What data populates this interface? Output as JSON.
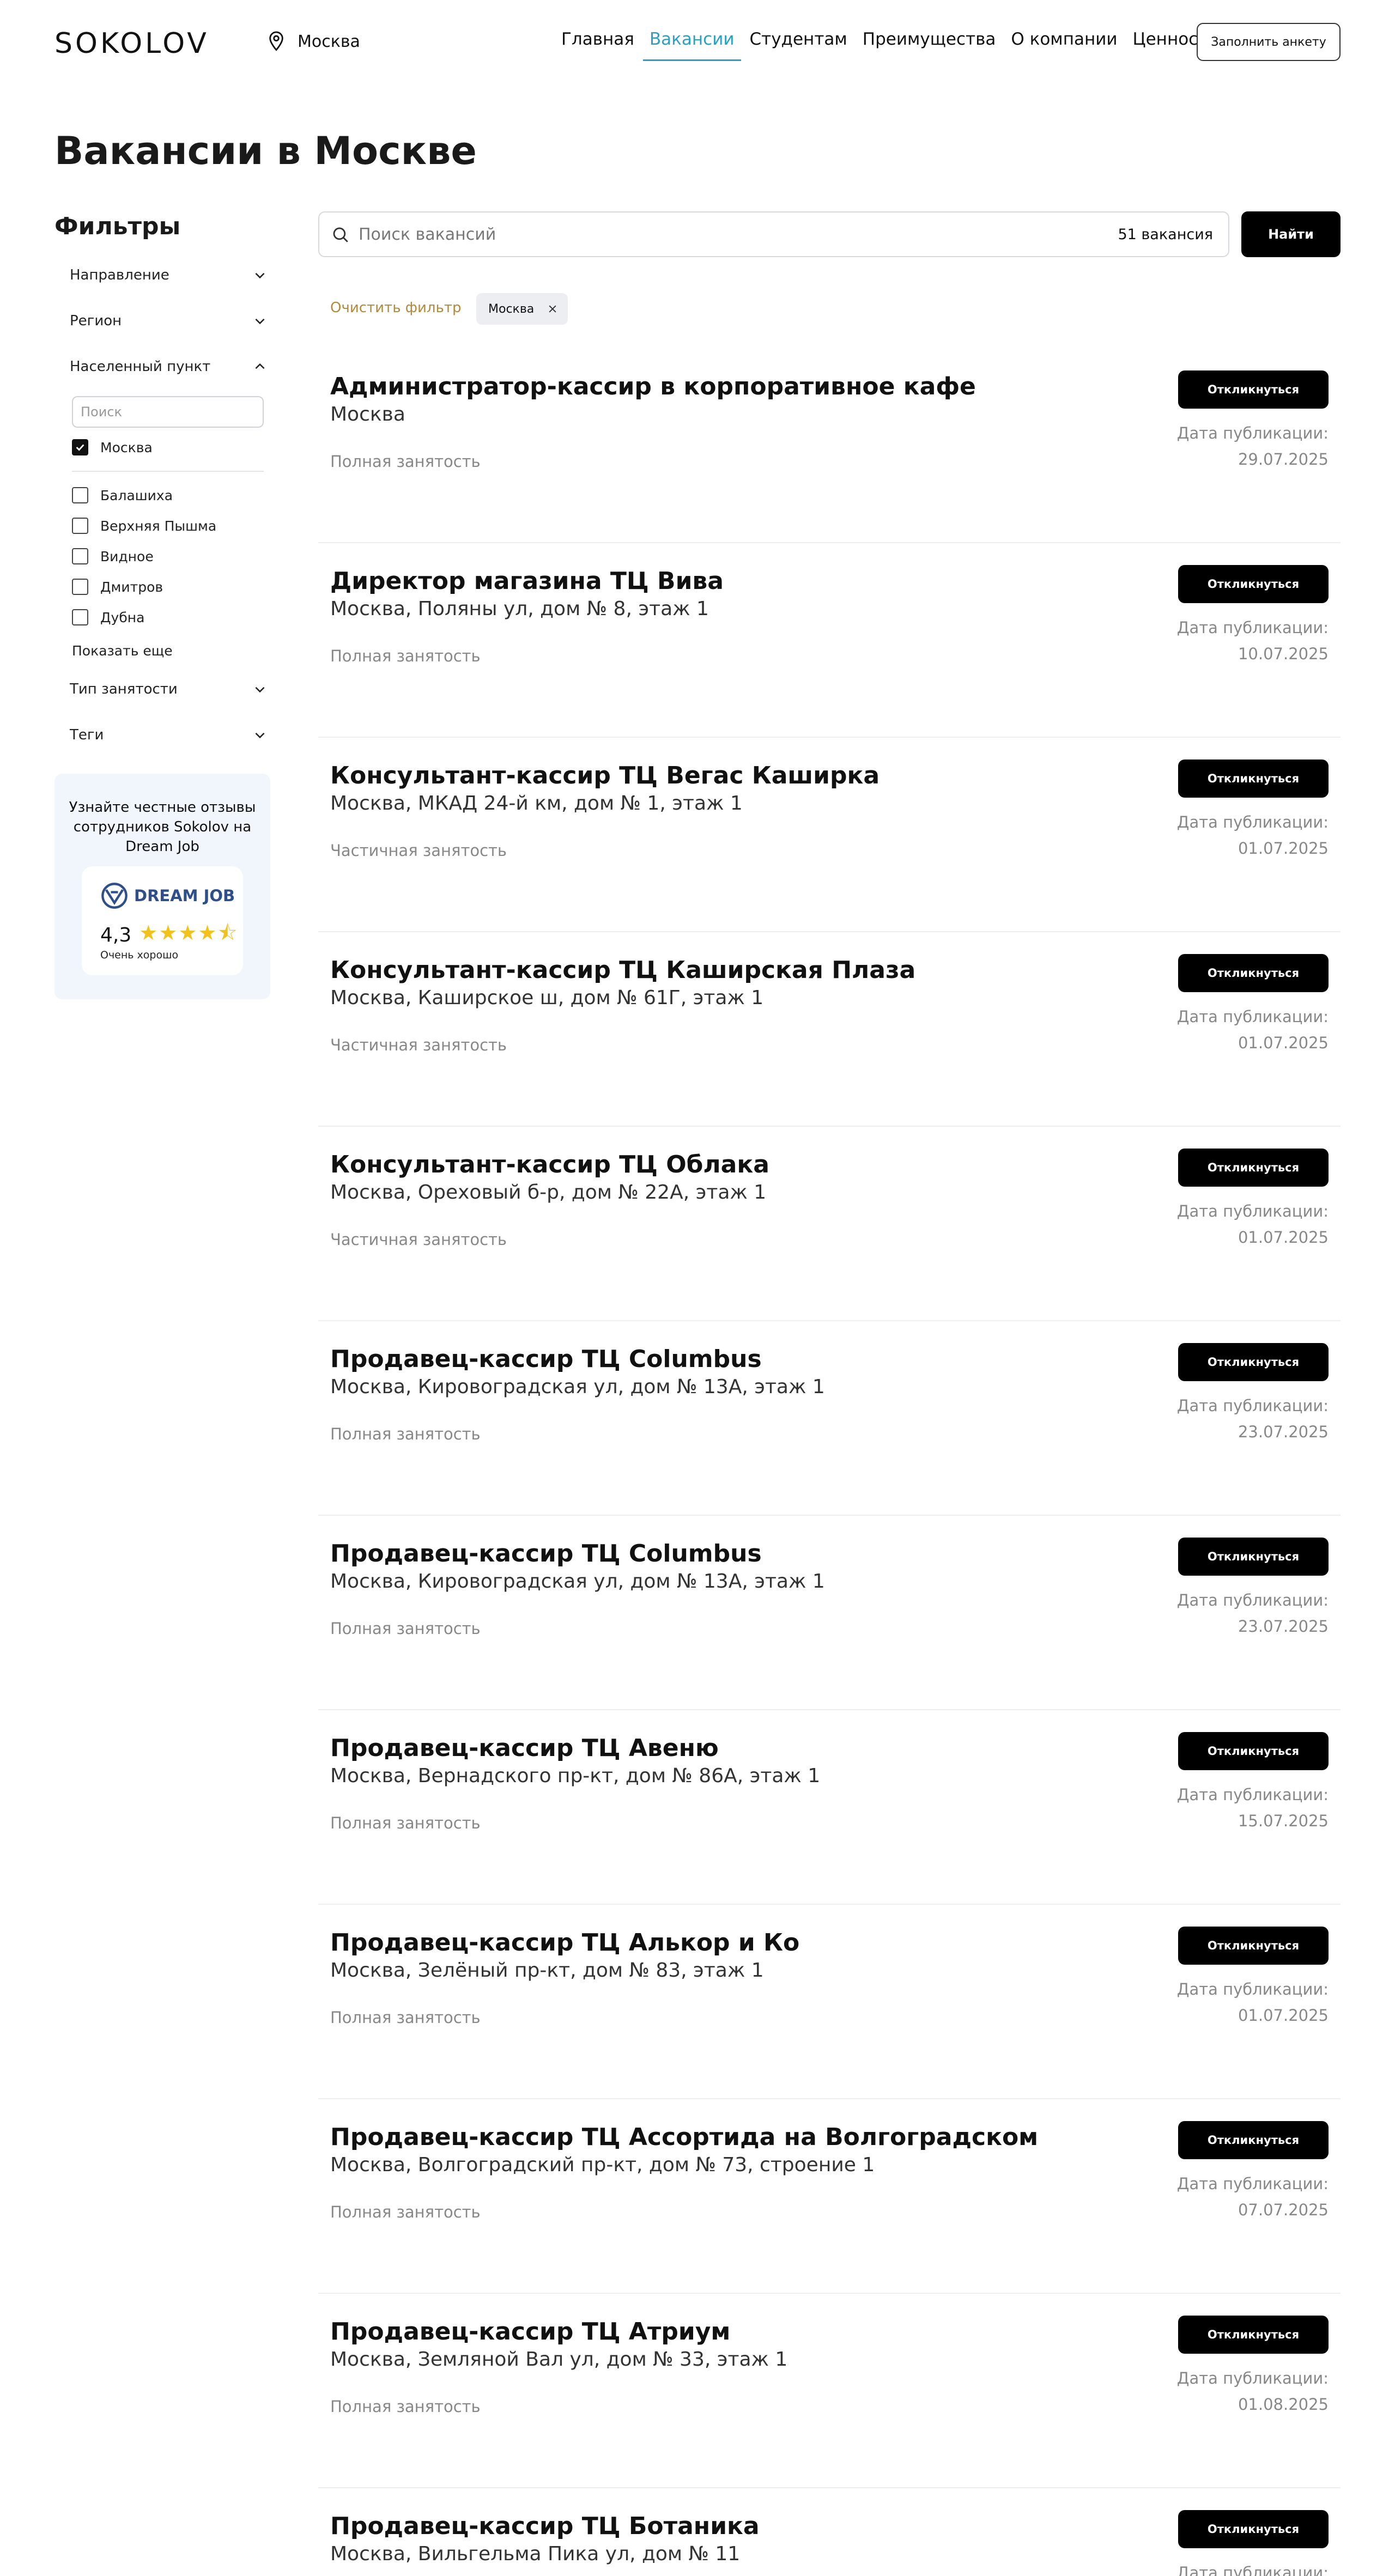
{
  "header": {
    "logo": "SOKOLOV",
    "city": "Москва",
    "nav": [
      "Главная",
      "Вакансии",
      "Студентам",
      "Преимущества",
      "О компании",
      "Ценности"
    ],
    "active_nav": "Вакансии",
    "fill_form_label": "Заполнить анкету"
  },
  "page_title": "Вакансии в Москве",
  "filters": {
    "title": "Фильтры",
    "direction": "Направление",
    "region": "Регион",
    "locality": "Населенный пункт",
    "locality_search_placeholder": "Поиск",
    "localities": [
      {
        "label": "Москва",
        "checked": true
      },
      {
        "label": "Балашиха",
        "checked": false
      },
      {
        "label": "Верхняя Пышма",
        "checked": false
      },
      {
        "label": "Видное",
        "checked": false
      },
      {
        "label": "Дмитров",
        "checked": false
      },
      {
        "label": "Дубна",
        "checked": false
      }
    ],
    "show_more": "Показать еще",
    "employment_type": "Тип занятости",
    "tags": "Теги"
  },
  "dream_job": {
    "text": "Узнайте честные отзывы сотрудников Sokolov на Dream Job",
    "logo": "DREAM JOB",
    "score": "4,3",
    "stars": "★★★★⯪",
    "label": "Очень хорошо"
  },
  "search": {
    "placeholder": "Поиск вакансий",
    "count": "51 вакансия",
    "button": "Найти"
  },
  "clear_filter": "Очистить фильтр",
  "active_chip": "Москва",
  "respond_label": "Откликнуться",
  "date_label": "Дата публикации:",
  "vacancies": [
    {
      "title": "Администратор-кассир в корпоративное кафе",
      "address": "Москва",
      "employment": "Полная занятость",
      "date": "29.07.2025"
    },
    {
      "title": "Директор магазина ТЦ Вива",
      "address": "Москва, Поляны ул, дом № 8, этаж 1",
      "employment": "Полная занятость",
      "date": "10.07.2025"
    },
    {
      "title": "Консультант-кассир ТЦ Вегас Каширка",
      "address": "Москва, МКАД 24-й км, дом № 1, этаж 1",
      "employment": "Частичная занятость",
      "date": "01.07.2025"
    },
    {
      "title": "Консультант-кассир ТЦ Каширская Плаза",
      "address": "Москва, Каширское ш, дом № 61Г, этаж 1",
      "employment": "Частичная занятость",
      "date": "01.07.2025"
    },
    {
      "title": "Консультант-кассир ТЦ Облака",
      "address": "Москва, Ореховый б-р, дом № 22А, этаж 1",
      "employment": "Частичная занятость",
      "date": "01.07.2025"
    },
    {
      "title": "Продавец-кассир ТЦ Columbus",
      "address": "Москва, Кировоградская ул, дом № 13А, этаж 1",
      "employment": "Полная занятость",
      "date": "23.07.2025"
    },
    {
      "title": "Продавец-кассир ТЦ Columbus",
      "address": "Москва, Кировоградская ул, дом № 13А, этаж 1",
      "employment": "Полная занятость",
      "date": "23.07.2025"
    },
    {
      "title": "Продавец-кассир ТЦ Авеню",
      "address": "Москва, Вернадского пр-кт, дом № 86А, этаж 1",
      "employment": "Полная занятость",
      "date": "15.07.2025"
    },
    {
      "title": "Продавец-кассир ТЦ Алькор и Ко",
      "address": "Москва, Зелёный пр-кт, дом № 83, этаж 1",
      "employment": "Полная занятость",
      "date": "01.07.2025"
    },
    {
      "title": "Продавец-кассир ТЦ Ассортида на Волгоградском",
      "address": "Москва, Волгоградский пр-кт, дом № 73, строение 1",
      "employment": "Полная занятость",
      "date": "07.07.2025"
    },
    {
      "title": "Продавец-кассир ТЦ Атриум",
      "address": "Москва, Земляной Вал ул, дом № 33, этаж 1",
      "employment": "Полная занятость",
      "date": "01.08.2025"
    },
    {
      "title": "Продавец-кассир ТЦ Ботаника",
      "address": "Москва, Вильгельма Пика ул, дом № 11",
      "employment": "",
      "date": ""
    }
  ]
}
